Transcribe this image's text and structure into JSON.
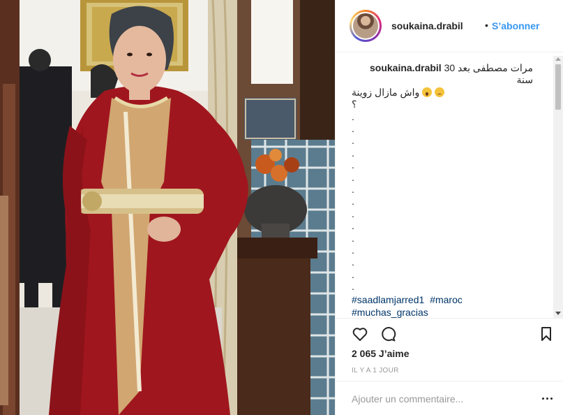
{
  "post": {
    "username": "soukaina.drabil",
    "follow_separator": "•",
    "follow_label": "S’abonner",
    "caption_user": "soukaina.drabil",
    "caption_line1": "مرات مصطفى بعد 30 سنة",
    "caption_line2": "واش مازال زوينة",
    "caption_line3": "؟",
    "dots": [
      ".",
      ".",
      ".",
      ".",
      ".",
      ".",
      ".",
      ".",
      ".",
      ".",
      ".",
      ".",
      ".",
      ".",
      "."
    ],
    "hashtags": [
      "#saadlamjarred1",
      "#maroc",
      "#muchas_gracias"
    ],
    "likes_text": "2 065 J’aime",
    "timestamp": "IL Y A 1 JOUR",
    "comment_placeholder": "Ajouter un commentaire..."
  },
  "icons": {
    "like": "heart-icon",
    "comment": "comment-icon",
    "save": "bookmark-icon",
    "more": "more-icon"
  },
  "colors": {
    "link": "#3897f0",
    "hashtag": "#003569",
    "text": "#262626",
    "muted": "#999999"
  }
}
